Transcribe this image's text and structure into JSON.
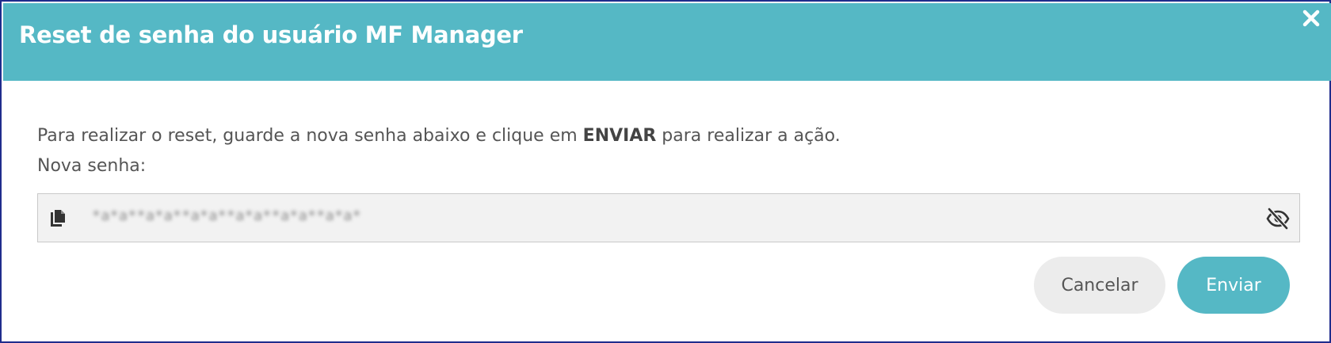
{
  "dialog": {
    "title": "Reset de senha do usuário MF Manager",
    "close_icon": "close-icon"
  },
  "instructions": {
    "prefix": "Para realizar o reset, guarde a nova senha abaixo e clique em ",
    "emphasis": "ENVIAR",
    "suffix": " para realizar a ação.",
    "new_password_label": "Nova senha:"
  },
  "password_field": {
    "value": "*a*a**a*a**a*a**a*a**a*a**a*a*",
    "copy_icon": "copy-icon",
    "visibility_icon": "eye-off-icon"
  },
  "buttons": {
    "cancel_label": "Cancelar",
    "send_label": "Enviar"
  },
  "colors": {
    "accent": "#55b8c5",
    "border": "#1f2c8c",
    "field_background": "#f2f2f2",
    "text": "#555555"
  }
}
